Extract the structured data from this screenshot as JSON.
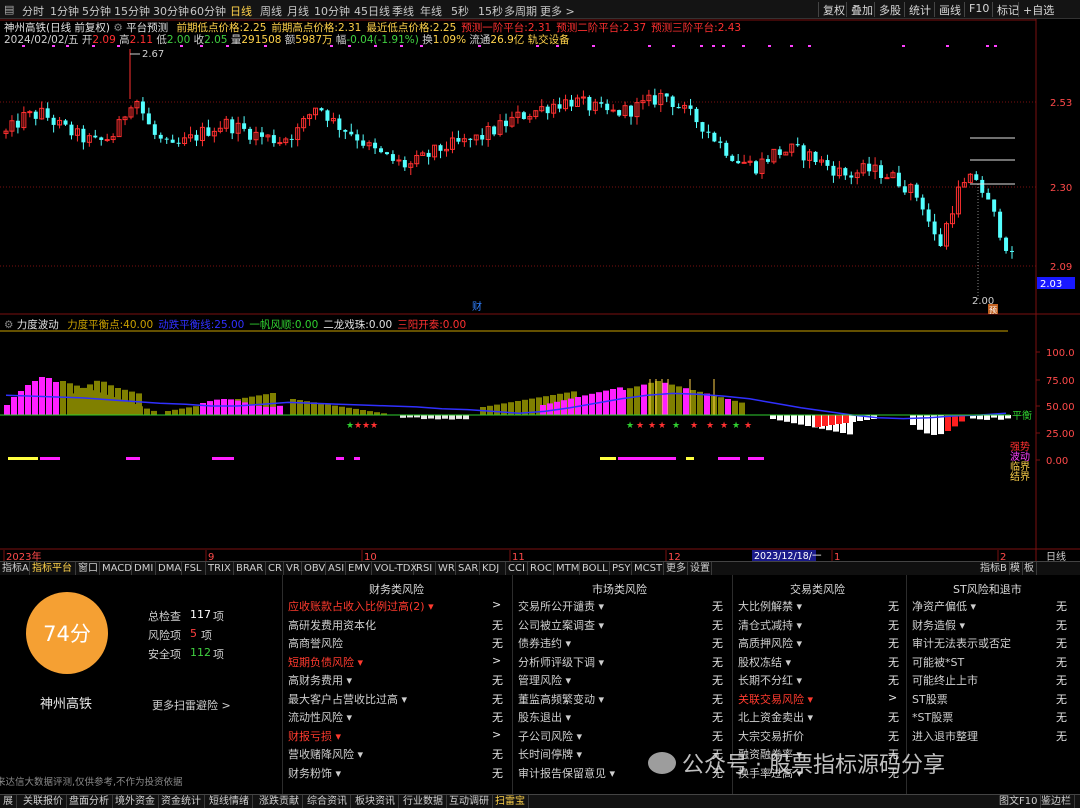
{
  "top_bar": {
    "periods": [
      "分时",
      "1分钟",
      "5分钟",
      "15分钟",
      "30分钟",
      "60分钟",
      "日线",
      "周线",
      "月线",
      "10分钟",
      "45日线",
      "季线",
      "年线",
      "5秒",
      "15秒",
      "多周期",
      "更多 >"
    ],
    "active_period": "日线",
    "right_buttons": [
      "复权",
      "叠加",
      "多股",
      "统计",
      "画线",
      "F10",
      "标记",
      "+自选"
    ]
  },
  "header": {
    "line1": {
      "stock": "神州高铁(日线 前复权)",
      "indicator": "平台预测",
      "items": [
        {
          "label": "前期低点价格:",
          "value": "2.25",
          "color": "#ffd24a"
        },
        {
          "label": "前期高点价格:",
          "value": "2.31",
          "color": "#ffd24a"
        },
        {
          "label": "最近低点价格:",
          "value": "2.25",
          "color": "#ffd24a"
        },
        {
          "label": "预测一阶平台:",
          "value": "2.31",
          "color": "#ff3030"
        },
        {
          "label": "预测二阶平台:",
          "value": "2.37",
          "color": "#ff3030"
        },
        {
          "label": "预测三阶平台:",
          "value": "2.43",
          "color": "#ff3030"
        }
      ]
    },
    "line2": {
      "date": "2024/02/02/五",
      "open_label": "开",
      "open": "2.09",
      "high_label": "高",
      "high": "2.11",
      "low_label": "低",
      "low": "2.00",
      "close_label": "收",
      "close": "2.05",
      "vol_label": "量",
      "vol": "291508",
      "amount_label": "额",
      "amount": "5987万",
      "chg_label": "幅",
      "chg": "-0.04(-1.91%)",
      "turnover_label": "换",
      "turnover": "1.09%",
      "float_label": "流通",
      "float": "26.9亿",
      "sector": "轨交设备"
    }
  },
  "price_axis": [
    "2.53",
    "2.30",
    "2.09",
    "2.03"
  ],
  "chart_annotations": {
    "high_marker": "2.67",
    "low_marker": "2.00",
    "event_marker": "财",
    "badge": "预"
  },
  "sub_header": {
    "name": "力度波动",
    "items": [
      {
        "label": "力度平衡点:",
        "value": "40.00",
        "color": "#c8a000"
      },
      {
        "label": "动跌平衡线:",
        "value": "25.00",
        "color": "#3030ff"
      },
      {
        "label": "一帆风顺:",
        "value": "0.00",
        "color": "#30d030"
      },
      {
        "label": "二龙戏珠:",
        "value": "0.00",
        "color": "#e0e0e0"
      },
      {
        "label": "三阳开泰:",
        "value": "0.00",
        "color": "#ff3030"
      }
    ]
  },
  "sub_axis": [
    "100.0",
    "75.00",
    "50.00",
    "25.00",
    "0.00"
  ],
  "sub_legend": {
    "balance": "平衡",
    "items": [
      "强势",
      "波动",
      "临界",
      "结界"
    ]
  },
  "date_axis": {
    "labels": [
      "2023年",
      "9",
      "10",
      "11",
      "12",
      "2023/12/18/一",
      "1",
      "2"
    ],
    "period": "日线"
  },
  "indicator_tabs": [
    "指标A",
    "指标平台",
    "窗口",
    "MACD",
    "DMI",
    "DMA",
    "FSL",
    "TRIX",
    "BRAR",
    "CR",
    "VR",
    "OBV",
    "ASI",
    "EMV",
    "VOL-TDX",
    "RSI",
    "WR",
    "SAR",
    "KDJ",
    "CCI",
    "ROC",
    "MTM",
    "BOLL",
    "PSY",
    "MCST",
    "更多",
    "设置"
  ],
  "indicator_right": [
    "指标B",
    "模",
    "板"
  ],
  "risk_panel": {
    "score": "74分",
    "stock_name": "神州高铁",
    "stats": [
      {
        "label": "总检查",
        "value": "117",
        "unit": "项",
        "color": "#ffffff"
      },
      {
        "label": "风险项",
        "value": "5",
        "unit": "项",
        "color": "#ff4040"
      },
      {
        "label": "安全项",
        "value": "112",
        "unit": "项",
        "color": "#40d040"
      }
    ],
    "more": "更多扫雷避险 >",
    "disclaimer": "以上信息来达信大数据评测,仅供参考,不作为投资依据",
    "columns": [
      {
        "title": "财务类风险",
        "rows": [
          {
            "name": "应收账款占收入比例过高(2) ▾",
            "val": ">",
            "red": true
          },
          {
            "name": "高研发费用资本化",
            "val": "无",
            "red": false
          },
          {
            "name": "高商誉风险",
            "val": "无",
            "red": false
          },
          {
            "name": "短期负债风险 ▾",
            "val": ">",
            "red": true
          },
          {
            "name": "高财务费用 ▾",
            "val": "无",
            "red": false
          },
          {
            "name": "最大客户占营收比过高 ▾",
            "val": "无",
            "red": false
          },
          {
            "name": "流动性风险 ▾",
            "val": "无",
            "red": false
          },
          {
            "name": "财报亏损 ▾",
            "val": ">",
            "red": true
          },
          {
            "name": "营收赌降风险 ▾",
            "val": "无",
            "red": false
          },
          {
            "name": "财务粉饰 ▾",
            "val": "无",
            "red": false
          }
        ]
      },
      {
        "title": "市场类风险",
        "rows": [
          {
            "name": "交易所公开谴责 ▾",
            "val": "无",
            "red": false
          },
          {
            "name": "公司被立案调查 ▾",
            "val": "无",
            "red": false
          },
          {
            "name": "债券违约 ▾",
            "val": "无",
            "red": false
          },
          {
            "name": "分析师评级下调 ▾",
            "val": "无",
            "red": false
          },
          {
            "name": "管理风险 ▾",
            "val": "无",
            "red": false
          },
          {
            "name": "董监高频繁变动 ▾",
            "val": "无",
            "red": false
          },
          {
            "name": "股东退出 ▾",
            "val": "无",
            "red": false
          },
          {
            "name": "子公司风险 ▾",
            "val": "无",
            "red": false
          },
          {
            "name": "长时间停牌 ▾",
            "val": "无",
            "red": false
          },
          {
            "name": "审计报告保留意见 ▾",
            "val": "无",
            "red": false
          }
        ]
      },
      {
        "title": "交易类风险",
        "rows": [
          {
            "name": "大比例解禁 ▾",
            "val": "无",
            "red": false
          },
          {
            "name": "清仓式减持 ▾",
            "val": "无",
            "red": false
          },
          {
            "name": "高质押风险 ▾",
            "val": "无",
            "red": false
          },
          {
            "name": "股权冻结 ▾",
            "val": "无",
            "red": false
          },
          {
            "name": "长期不分红 ▾",
            "val": "无",
            "red": false
          },
          {
            "name": "关联交易风险 ▾",
            "val": ">",
            "red": true
          },
          {
            "name": "北上资金卖出 ▾",
            "val": "无",
            "red": false
          },
          {
            "name": "大宗交易折价",
            "val": "无",
            "red": false
          },
          {
            "name": "融资融券率 ▾",
            "val": "无",
            "red": false
          },
          {
            "name": "换手率过高 ▾",
            "val": "无",
            "red": false
          }
        ]
      },
      {
        "title": "ST风险和退市",
        "rows": [
          {
            "name": "净资产偏低 ▾",
            "val": "无",
            "red": false
          },
          {
            "name": "财务造假 ▾",
            "val": "无",
            "red": false
          },
          {
            "name": "审计无法表示或否定",
            "val": "无",
            "red": false
          },
          {
            "name": "可能被*ST",
            "val": "无",
            "red": false
          },
          {
            "name": "可能终止上市",
            "val": "无",
            "red": false
          },
          {
            "name": "ST股票",
            "val": "无",
            "red": false
          },
          {
            "name": "*ST股票",
            "val": "无",
            "red": false
          },
          {
            "name": "进入退市整理",
            "val": "无",
            "red": false
          }
        ]
      }
    ]
  },
  "watermark": "公众号 · 股票指标源码分享",
  "bottom_bar": {
    "items": [
      "展",
      "关联报价",
      "盘面分析",
      "境外资金",
      "资金统计",
      "短线情绪",
      "涨跌贡献",
      "综合资讯",
      "板块资讯",
      "行业数据",
      "互动调研",
      "扫雷宝"
    ],
    "active": "扫雷宝",
    "right": [
      "图文F10",
      "鉴边栏"
    ]
  },
  "colors": {
    "up": "#ff3030",
    "down": "#54ffff",
    "volume_bar": "#ff40ff",
    "olive": "#808000",
    "ma": "#3030ff",
    "score_circle": "#f5a033"
  },
  "chart_data": {
    "type": "candlestick",
    "y_range": [
      1.93,
      2.72
    ],
    "trend_anchors": [
      2.43,
      2.48,
      2.49,
      2.45,
      2.42,
      2.4,
      2.43,
      2.55,
      2.43,
      2.38,
      2.41,
      2.44,
      2.46,
      2.44,
      2.42,
      2.41,
      2.44,
      2.52,
      2.46,
      2.43,
      2.38,
      2.35,
      2.33,
      2.36,
      2.39,
      2.4,
      2.42,
      2.45,
      2.48,
      2.5,
      2.52,
      2.53,
      2.51,
      2.49,
      2.5,
      2.52,
      2.55,
      2.5,
      2.46,
      2.4,
      2.35,
      2.33,
      2.37,
      2.38,
      2.36,
      2.33,
      2.3,
      2.32,
      2.31,
      2.28,
      2.23,
      2.08,
      2.25,
      2.3,
      2.18,
      2.05
    ]
  }
}
